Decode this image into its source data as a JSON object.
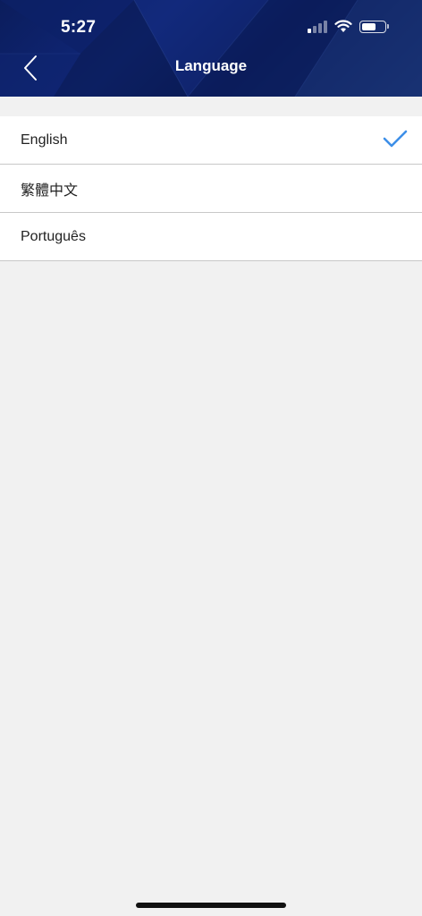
{
  "status_bar": {
    "time": "5:27",
    "signal_icon": "signal-icon",
    "wifi_icon": "wifi-icon",
    "battery_icon": "battery-icon",
    "battery_level": 0.6
  },
  "nav": {
    "title": "Language",
    "back_icon": "chevron-left-icon"
  },
  "languages": [
    {
      "label": "English",
      "selected": true
    },
    {
      "label": "繁體中文",
      "selected": false
    },
    {
      "label": "Português",
      "selected": false
    }
  ],
  "colors": {
    "header": "#0b1d5c",
    "checkmark": "#3d8fe8",
    "background": "#f1f1f1"
  }
}
